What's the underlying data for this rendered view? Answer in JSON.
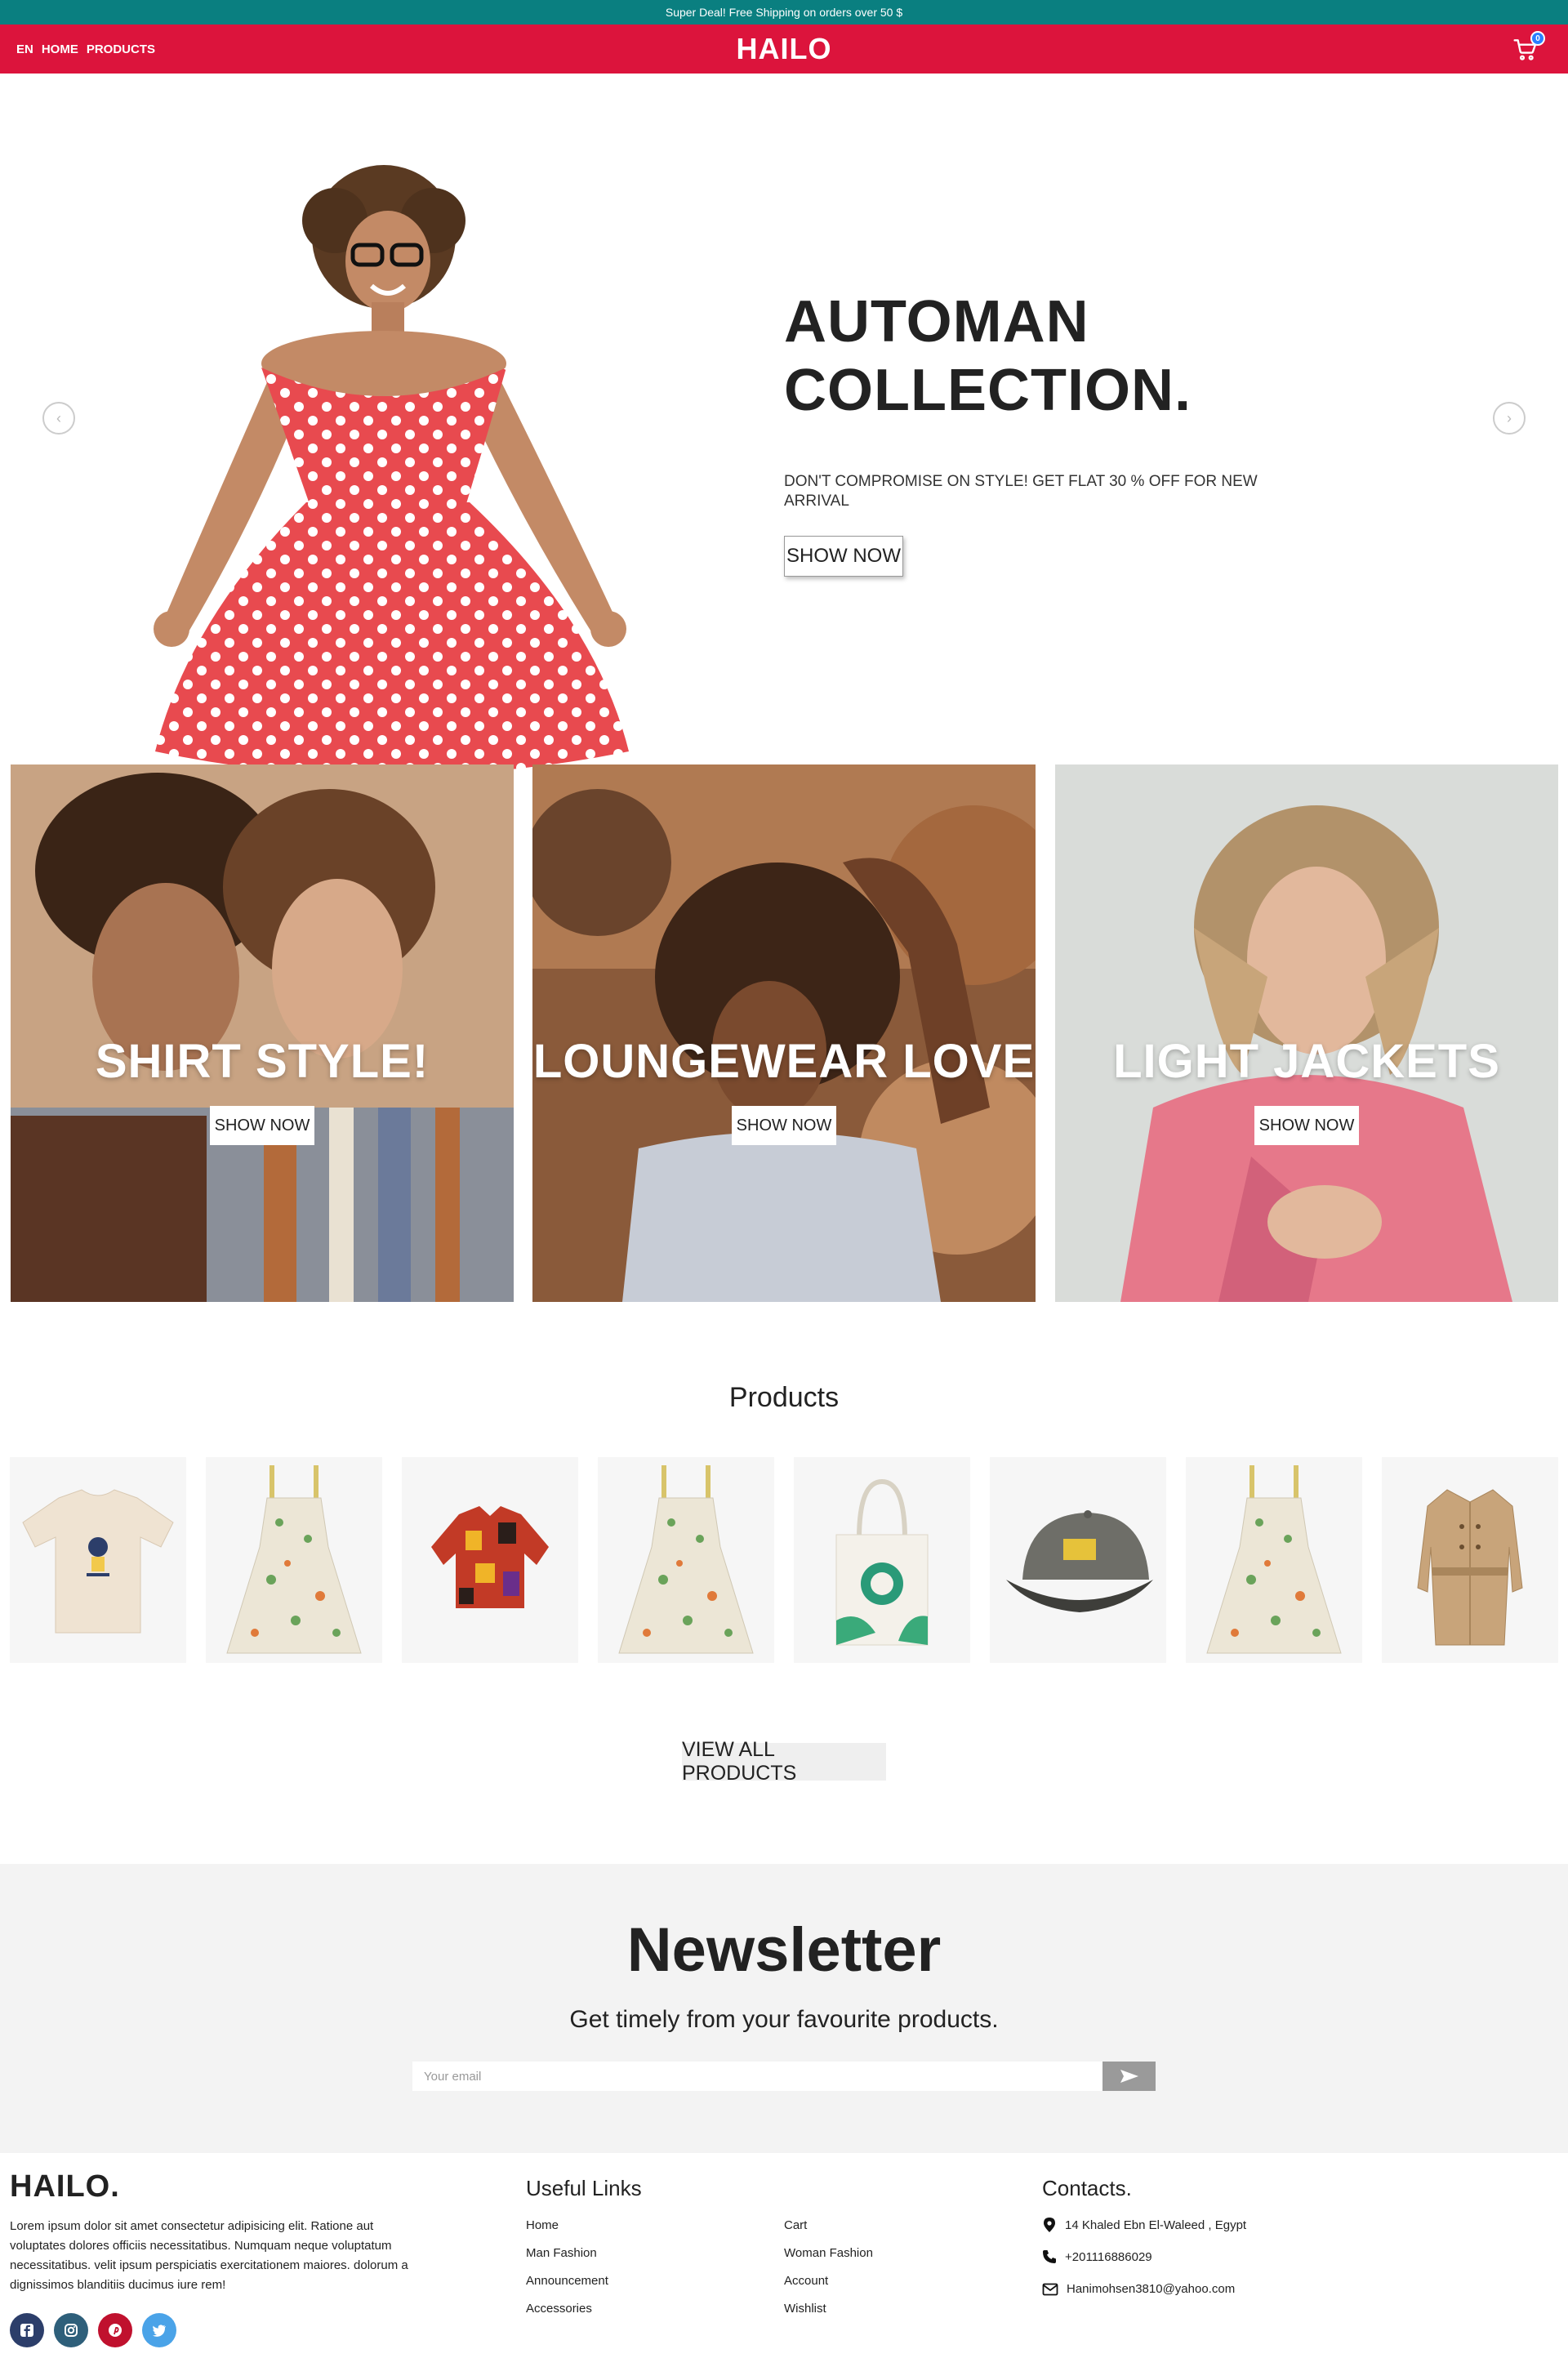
{
  "promo": {
    "text": "Super Deal! Free Shipping on orders over 50 $"
  },
  "nav": {
    "lang": "EN",
    "links": [
      "HOME",
      "PRODUCTS"
    ],
    "brand": "HAILO",
    "cart_count": "0"
  },
  "hero": {
    "title_line1": "AUTOMAN",
    "title_line2": "COLLECTION.",
    "subtitle": "DON'T COMPROMISE ON STYLE! GET FLAT 30 % OFF FOR NEW ARRIVAL",
    "button": "SHOW NOW"
  },
  "categories": [
    {
      "title": "SHIRT STYLE!",
      "button": "SHOW NOW"
    },
    {
      "title": "LOUNGEWEAR LOVE",
      "button": "SHOW NOW"
    },
    {
      "title": "LIGHT JACKETS",
      "button": "SHOW NOW"
    }
  ],
  "products": {
    "title": "Products",
    "items": [
      "t-shirt",
      "floral-dress",
      "print-shirt",
      "floral-dress",
      "tote-bag",
      "cap",
      "floral-dress",
      "trench-coat"
    ],
    "view_all": "VIEW ALL PRODUCTS"
  },
  "newsletter": {
    "title": "Newsletter",
    "subtitle": "Get timely from your favourite products.",
    "placeholder": "Your email"
  },
  "footer": {
    "brand": "HAILO.",
    "about": "Lorem ipsum dolor sit amet consectetur adipisicing elit. Ratione aut voluptates dolores officiis necessitatibus. Numquam neque voluptatum necessitatibus. velit ipsum perspiciatis exercitationem maiores. dolorum a dignissimos blanditiis ducimus iure rem!",
    "socials": [
      "facebook-icon",
      "instagram-icon",
      "pinterest-icon",
      "twitter-icon"
    ],
    "useful_links_title": "Useful Links",
    "links_col1": [
      "Home",
      "Man Fashion",
      "Announcement",
      "Accessories"
    ],
    "links_col2": [
      "Cart",
      "Woman Fashion",
      "Account",
      "Wishlist"
    ],
    "contacts_title": "Contacts.",
    "address": "14 Khaled Ebn El-Waleed , Egypt",
    "phone": "+201116886029",
    "email": "Hanimohsen3810@yahoo.com"
  },
  "colors": {
    "promo_bg": "#0a7f80",
    "nav_bg": "#dc143c",
    "newsletter_bg": "#f3f3f3"
  }
}
